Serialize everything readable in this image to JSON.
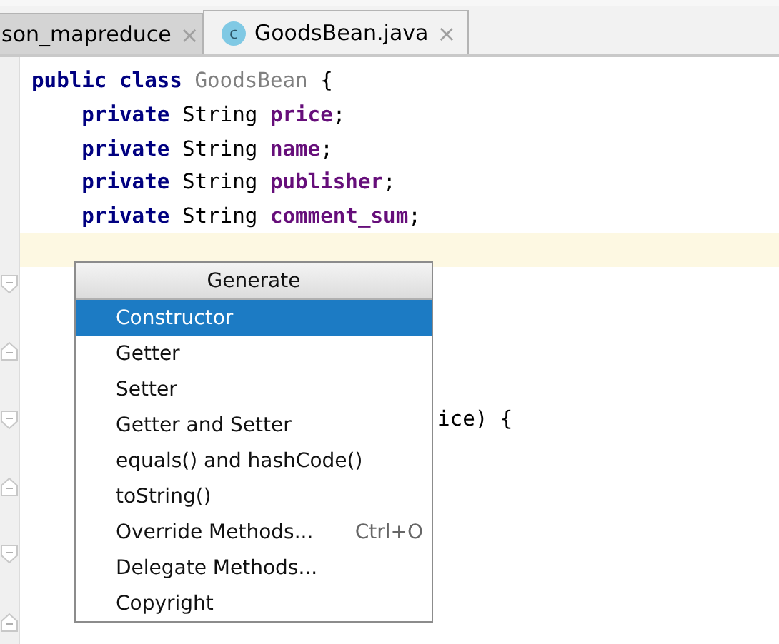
{
  "tabs": [
    {
      "label": "son_mapreduce",
      "selected": false,
      "close": "×"
    },
    {
      "label": "GoodsBean.java",
      "selected": true,
      "icon_letter": "c",
      "close": "×"
    }
  ],
  "code_lines": [
    {
      "current": false,
      "tokens": [
        {
          "text": "public class ",
          "kind": "keyword"
        },
        {
          "text": "GoodsBean",
          "kind": "unused"
        },
        {
          "text": " {",
          "kind": "plain"
        }
      ]
    },
    {
      "current": false,
      "tokens": [
        {
          "text": "    private ",
          "kind": "keyword"
        },
        {
          "text": "String ",
          "kind": "plain"
        },
        {
          "text": "price",
          "kind": "field"
        },
        {
          "text": ";",
          "kind": "plain"
        }
      ]
    },
    {
      "current": false,
      "tokens": [
        {
          "text": "    private ",
          "kind": "keyword"
        },
        {
          "text": "String ",
          "kind": "plain"
        },
        {
          "text": "name",
          "kind": "field"
        },
        {
          "text": ";",
          "kind": "plain"
        }
      ]
    },
    {
      "current": false,
      "tokens": [
        {
          "text": "    private ",
          "kind": "keyword"
        },
        {
          "text": "String ",
          "kind": "plain"
        },
        {
          "text": "publisher",
          "kind": "field"
        },
        {
          "text": ";",
          "kind": "plain"
        }
      ]
    },
    {
      "current": false,
      "tokens": [
        {
          "text": "    private ",
          "kind": "keyword"
        },
        {
          "text": "String ",
          "kind": "plain"
        },
        {
          "text": "comment_sum",
          "kind": "field"
        },
        {
          "text": ";",
          "kind": "plain"
        }
      ]
    },
    {
      "current": true
    },
    {
      "current": false,
      "fold": {
        "kind": "start"
      }
    },
    {
      "current": false
    },
    {
      "current": false,
      "fold": {
        "kind": "end"
      }
    },
    {
      "current": false
    },
    {
      "current": false,
      "fold": {
        "kind": "start"
      },
      "behind_popup": true,
      "tokens": [
        {
          "text": "ice) {",
          "kind": "plain"
        }
      ]
    },
    {
      "current": false
    },
    {
      "current": false,
      "fold": {
        "kind": "end"
      }
    },
    {
      "current": false
    },
    {
      "current": false,
      "fold": {
        "kind": "start"
      }
    },
    {
      "current": false
    },
    {
      "current": false,
      "fold": {
        "kind": "end"
      }
    }
  ],
  "popup": {
    "title": "Generate",
    "items": [
      {
        "label": "Constructor",
        "selected": true
      },
      {
        "label": "Getter",
        "selected": false
      },
      {
        "label": "Setter",
        "selected": false
      },
      {
        "label": "Getter and Setter",
        "selected": false
      },
      {
        "label": "equals() and hashCode()",
        "selected": false
      },
      {
        "label": "toString()",
        "selected": false
      },
      {
        "label": "Override Methods...",
        "selected": false,
        "shortcut": "Ctrl+O"
      },
      {
        "label": "Delegate Methods...",
        "selected": false
      },
      {
        "label": "Copyright",
        "selected": false
      }
    ]
  }
}
